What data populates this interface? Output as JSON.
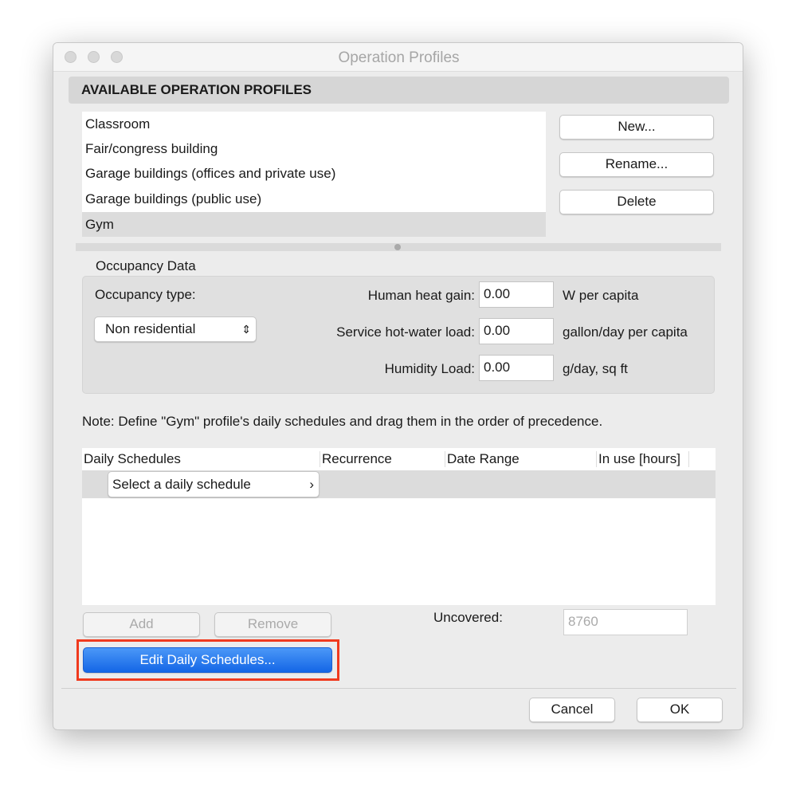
{
  "window": {
    "title": "Operation Profiles"
  },
  "profiles": {
    "header": "AVAILABLE OPERATION PROFILES",
    "items": [
      "Classroom",
      "Fair/congress building",
      "Garage buildings (offices and private use)",
      "Garage buildings (public use)",
      "Gym"
    ],
    "selected": "Gym",
    "new_label": "New...",
    "rename_label": "Rename...",
    "delete_label": "Delete"
  },
  "occupancy": {
    "group_label": "Occupancy Data",
    "type_label": "Occupancy type:",
    "type_value": "Non residential",
    "heat_label": "Human heat gain:",
    "heat_value": "0.00",
    "heat_unit": "W per capita",
    "water_label": "Service hot-water load:",
    "water_value": "0.00",
    "water_unit": "gallon/day per capita",
    "humidity_label": "Humidity Load:",
    "humidity_value": "0.00",
    "humidity_unit": "g/day, sq ft"
  },
  "note": "Note: Define \"Gym\" profile's daily schedules and drag them in the order of precedence.",
  "schedules": {
    "columns": [
      "Daily Schedules",
      "Recurrence",
      "Date Range",
      "In use [hours]"
    ],
    "select_label": "Select a daily schedule",
    "add_label": "Add",
    "remove_label": "Remove",
    "uncovered_label": "Uncovered:",
    "uncovered_value": "8760",
    "edit_label": "Edit Daily Schedules..."
  },
  "footer": {
    "cancel_label": "Cancel",
    "ok_label": "OK"
  },
  "colors": {
    "accent": "#1a6ff0",
    "highlight": "#f03a1e"
  }
}
